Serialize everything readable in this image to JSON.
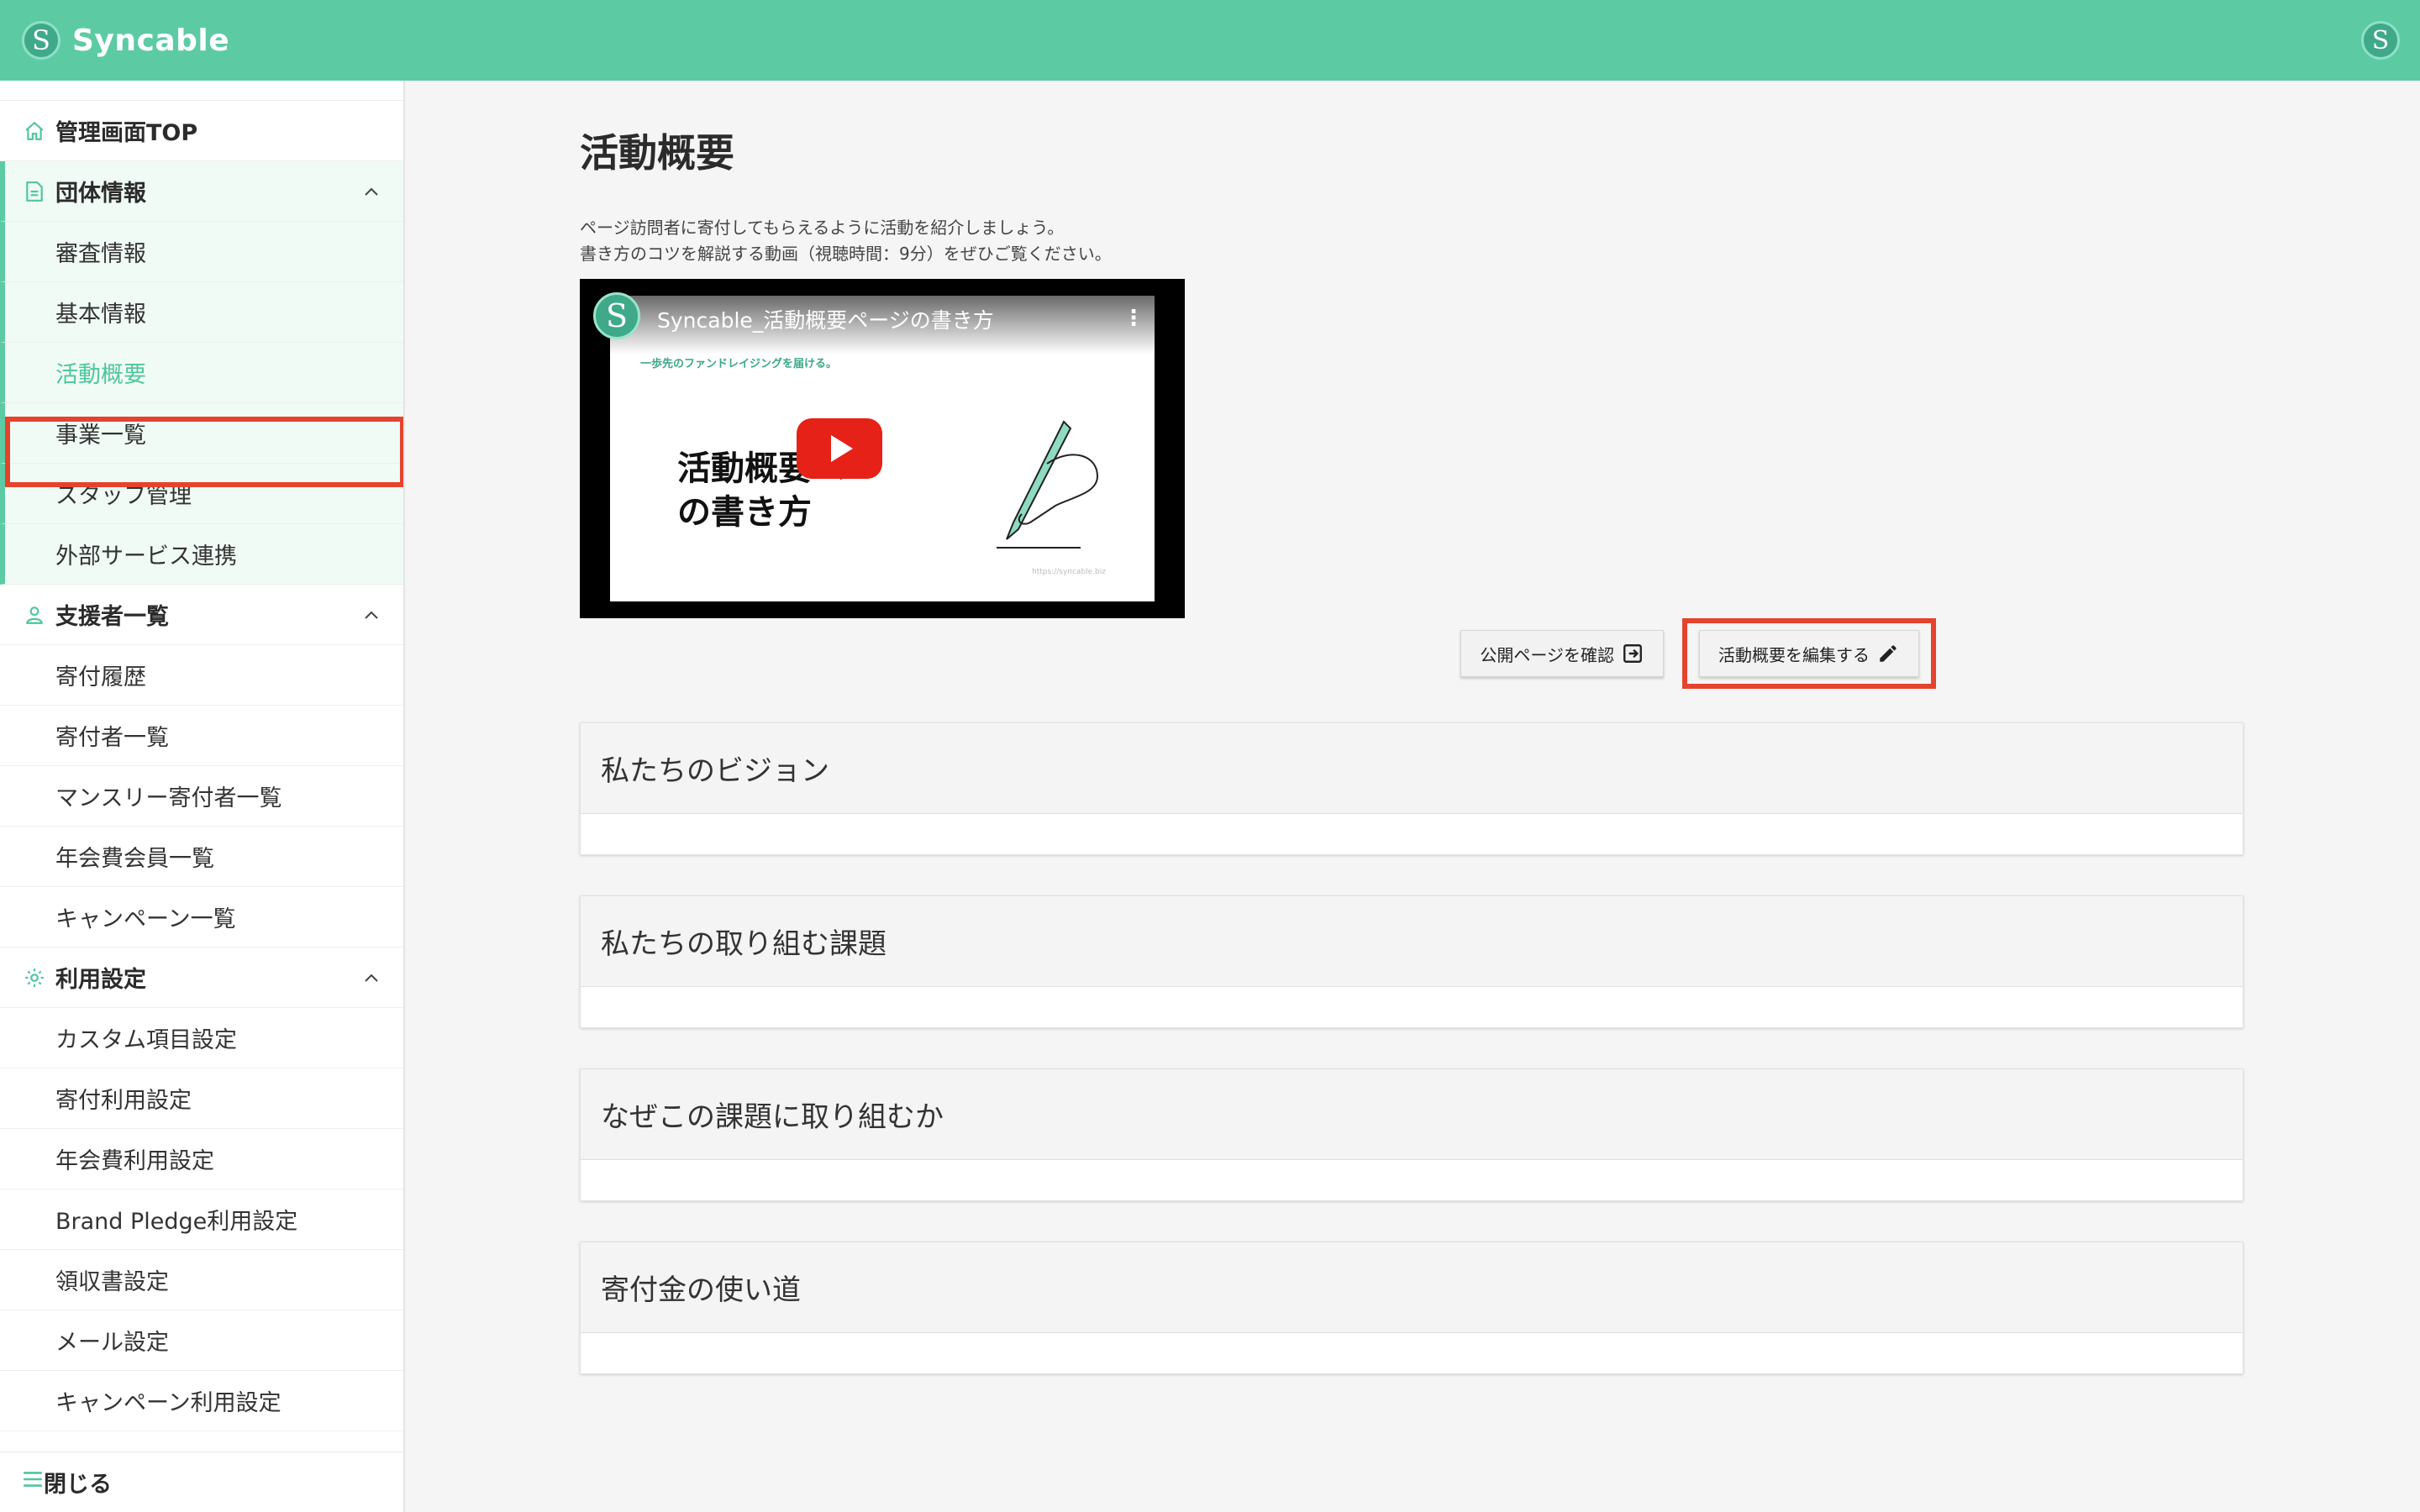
{
  "app": {
    "brand": "Syncable",
    "logo_letter": "S",
    "accent_color": "#5ccba4",
    "highlight_color": "#e4432e"
  },
  "sidebar": {
    "top": {
      "label": "管理画面TOP",
      "icon": "home-icon"
    },
    "groups": [
      {
        "label": "団体情報",
        "icon": "document-icon",
        "items": [
          "審査情報",
          "基本情報",
          "活動概要",
          "事業一覧",
          "スタッフ管理",
          "外部サービス連携"
        ],
        "active_index": 2
      },
      {
        "label": "支援者一覧",
        "icon": "person-icon",
        "items": [
          "寄付履歴",
          "寄付者一覧",
          "マンスリー寄付者一覧",
          "年会費会員一覧",
          "キャンペーン一覧"
        ]
      },
      {
        "label": "利用設定",
        "icon": "gear-icon",
        "items": [
          "カスタム項目設定",
          "寄付利用設定",
          "年会費利用設定",
          "Brand Pledge利用設定",
          "領収書設定",
          "メール設定",
          "キャンペーン利用設定"
        ]
      }
    ],
    "close_label": "閉じる"
  },
  "main": {
    "title": "活動概要",
    "description_lines": [
      "ページ訪問者に寄付してもらえるように活動を紹介しましょう。",
      "書き方のコツを解説する動画（視聴時間：9分）をぜひご覧ください。"
    ],
    "video": {
      "title": "Syncable_活動概要ページの書き方",
      "subtitle": "一歩先のファンドレイジングを届ける。",
      "thumbnail_text_line1": "活動概要ペー",
      "thumbnail_text_line2": "の書き方",
      "url_text": "https://syncable.biz"
    },
    "buttons": {
      "public_page": "公開ページを確認",
      "edit": "活動概要を編集する"
    },
    "sections": [
      "私たちのビジョン",
      "私たちの取り組む課題",
      "なぜこの課題に取り組むか",
      "寄付金の使い道"
    ]
  }
}
